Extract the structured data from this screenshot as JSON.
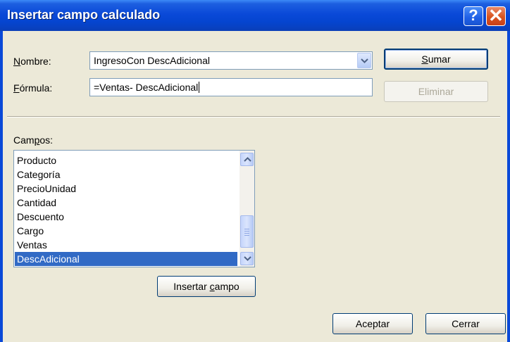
{
  "window": {
    "title": "Insertar campo calculado",
    "help_glyph": "?",
    "close_glyph": "✕"
  },
  "form": {
    "name_label_accel": "N",
    "name_label_rest": "ombre:",
    "name_value": "IngresoCon DescAdicional",
    "formula_label_accel": "F",
    "formula_label_rest": "órmula:",
    "formula_value": "=Ventas- DescAdicional"
  },
  "buttons": {
    "add_accel": "S",
    "add_rest": "umar",
    "delete": "Eliminar",
    "insert_pre": "Insertar ",
    "insert_accel": "c",
    "insert_rest": "ampo",
    "ok": "Aceptar",
    "close": "Cerrar"
  },
  "fields": {
    "label_pre": "Cam",
    "label_accel": "p",
    "label_rest": "os:",
    "items": [
      "Producto",
      "Categoría",
      "PrecioUnidad",
      "Cantidad",
      "Descuento",
      "Cargo",
      "Ventas",
      "DescAdicional"
    ],
    "selected": "DescAdicional"
  },
  "colors": {
    "titlebar": "#0a49d8",
    "selection": "#316ac5",
    "dialog_bg": "#ECE9D8"
  }
}
